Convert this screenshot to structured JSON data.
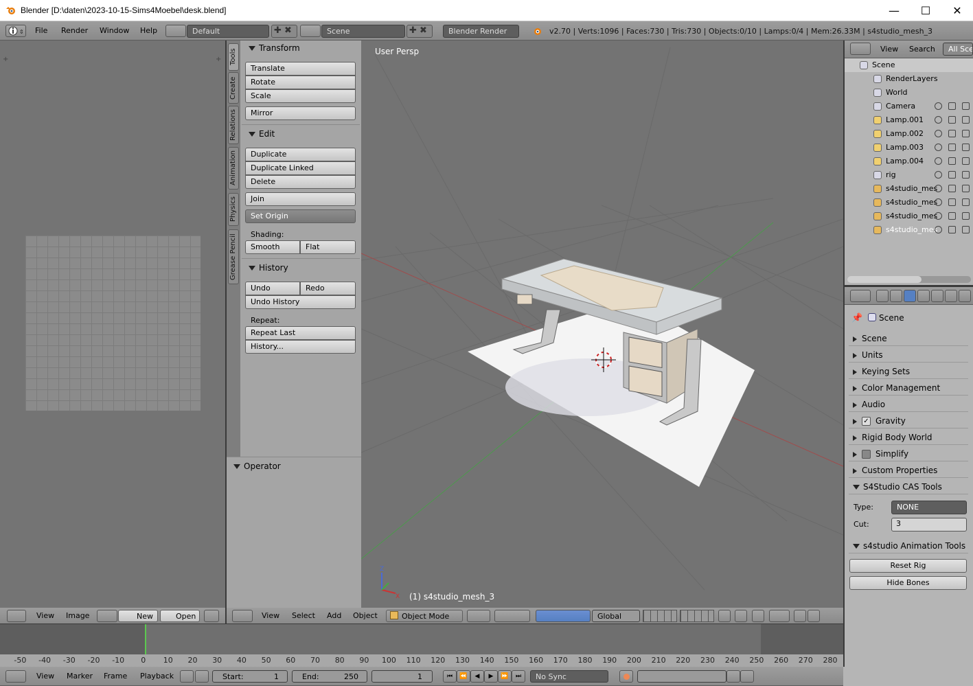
{
  "window": {
    "title": "Blender  [D:\\daten\\2023-10-15-Sims4Moebel\\desk.blend]",
    "minimize": "—",
    "maximize": "☐",
    "close": "✕"
  },
  "info_header": {
    "menus": [
      "File",
      "Render",
      "Window",
      "Help"
    ],
    "layout": "Default",
    "scene": "Scene",
    "engine": "Blender Render",
    "stats": "v2.70 | Verts:1096 | Faces:730 | Tris:730 | Objects:0/10 | Lamps:0/4 | Mem:26.33M | s4studio_mesh_3"
  },
  "image_editor": {
    "menus": [
      "View",
      "Image"
    ],
    "new_label": "New",
    "open_label": "Open"
  },
  "tool_tabs": [
    "Tools",
    "Create",
    "Relations",
    "Animation",
    "Physics",
    "Grease Pencil"
  ],
  "tools": {
    "transform_title": "Transform",
    "translate": "Translate",
    "rotate": "Rotate",
    "scale": "Scale",
    "mirror": "Mirror",
    "edit_title": "Edit",
    "duplicate": "Duplicate",
    "duplicate_linked": "Duplicate Linked",
    "delete": "Delete",
    "join": "Join",
    "set_origin": "Set Origin",
    "shading_label": "Shading:",
    "smooth": "Smooth",
    "flat": "Flat",
    "history_title": "History",
    "undo": "Undo",
    "redo": "Redo",
    "undo_history": "Undo History",
    "repeat_label": "Repeat:",
    "repeat_last": "Repeat Last",
    "history_more": "History...",
    "operator_title": "Operator"
  },
  "viewport": {
    "view_label": "User Persp",
    "object_label": "(1) s4studio_mesh_3",
    "menus": [
      "View",
      "Select",
      "Add",
      "Object"
    ],
    "mode": "Object Mode",
    "orientation": "Global"
  },
  "outliner": {
    "menus": [
      "View",
      "Search"
    ],
    "filter": "All Sce",
    "items": [
      {
        "label": "Scene",
        "icon": "scene-icon"
      },
      {
        "label": "RenderLayers",
        "icon": "renderlayers-icon"
      },
      {
        "label": "World",
        "icon": "world-icon"
      },
      {
        "label": "Camera",
        "icon": "camera-icon"
      },
      {
        "label": "Lamp.001",
        "icon": "lamp-icon"
      },
      {
        "label": "Lamp.002",
        "icon": "lamp-icon"
      },
      {
        "label": "Lamp.003",
        "icon": "lamp-icon"
      },
      {
        "label": "Lamp.004",
        "icon": "lamp-icon"
      },
      {
        "label": "rig",
        "icon": "armature-icon"
      },
      {
        "label": "s4studio_mes",
        "icon": "mesh-icon"
      },
      {
        "label": "s4studio_mes",
        "icon": "mesh-icon"
      },
      {
        "label": "s4studio_mes",
        "icon": "mesh-icon"
      },
      {
        "label": "s4studio_mes",
        "icon": "mesh-icon"
      }
    ]
  },
  "properties": {
    "context": "Scene",
    "panels": [
      "Scene",
      "Units",
      "Keying Sets",
      "Color Management",
      "Audio",
      "Gravity",
      "Rigid Body World",
      "Simplify",
      "Custom Properties",
      "S4Studio CAS Tools"
    ],
    "type_label": "Type:",
    "type_value": "NONE",
    "cut_label": "Cut:",
    "cut_value": "3",
    "anim_title": "s4studio Animation Tools",
    "reset_rig": "Reset Rig",
    "hide_bones": "Hide Bones"
  },
  "timeline": {
    "ticks": [
      "-50",
      "-40",
      "-30",
      "-20",
      "-10",
      "0",
      "10",
      "20",
      "30",
      "40",
      "50",
      "60",
      "70",
      "80",
      "90",
      "100",
      "110",
      "120",
      "130",
      "140",
      "150",
      "160",
      "170",
      "180",
      "190",
      "200",
      "210",
      "220",
      "230",
      "240",
      "250",
      "260",
      "270",
      "280"
    ],
    "menus": [
      "View",
      "Marker",
      "Frame",
      "Playback"
    ],
    "start_label": "Start:",
    "start_value": "1",
    "end_label": "End:",
    "end_value": "250",
    "current_frame": "1",
    "sync": "No Sync"
  },
  "colors": {
    "viewport_bg": "#737373",
    "panel_bg": "#a5a5a5",
    "header_bg": "#939393",
    "accent_blue": "#5680c2"
  }
}
